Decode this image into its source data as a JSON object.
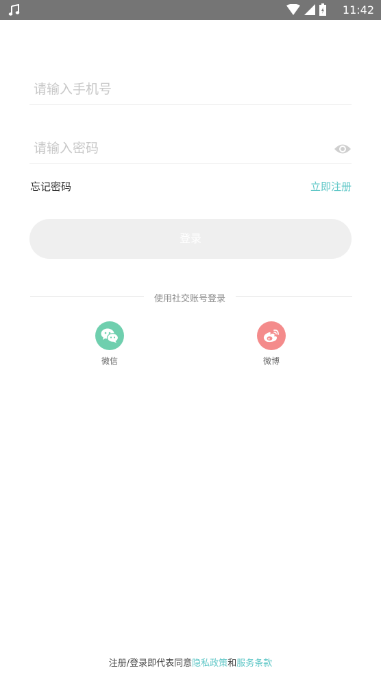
{
  "status_bar": {
    "time": "11:42",
    "icons": [
      "music-note-icon",
      "wifi-icon",
      "signal-icon",
      "battery-icon"
    ]
  },
  "form": {
    "phone_placeholder": "请输入手机号",
    "password_placeholder": "请输入密码",
    "forgot_label": "忘记密码",
    "register_label": "立即注册",
    "login_label": "登录"
  },
  "social": {
    "caption": "使用社交账号登录",
    "wechat_label": "微信",
    "weibo_label": "微博"
  },
  "agreement": {
    "prefix": "注册/登录即代表同意",
    "privacy": "隐私政策",
    "and": "和",
    "terms": "服务条款"
  },
  "colors": {
    "accent": "#5fc7c7",
    "wechat": "#6fcfae",
    "weibo": "#f48b8b",
    "status_bar": "#757575"
  }
}
